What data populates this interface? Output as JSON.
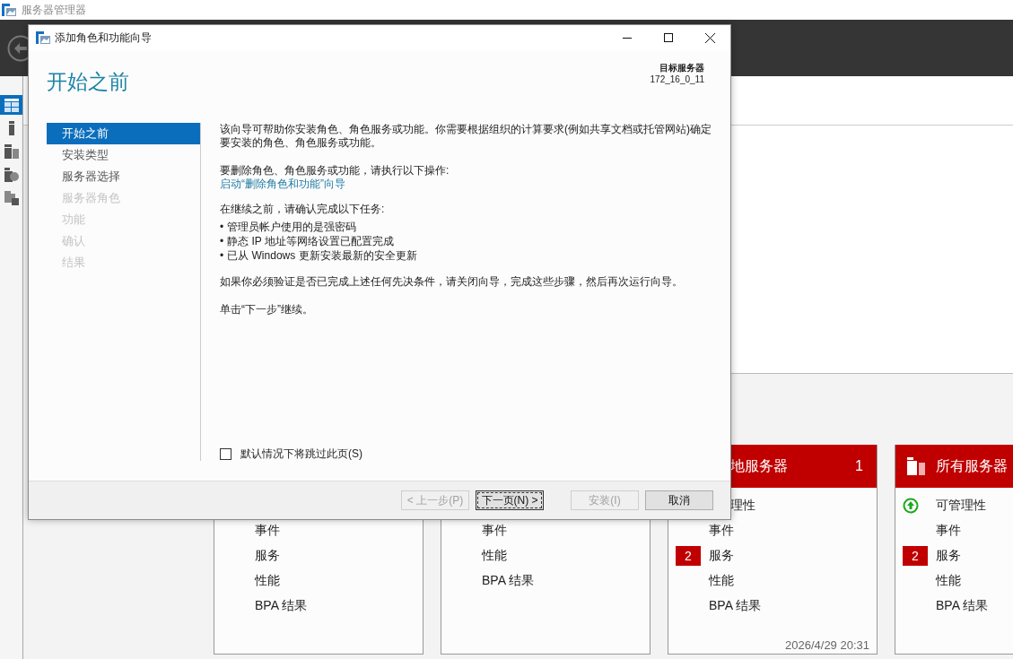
{
  "app": {
    "title": "服务器管理器"
  },
  "nav_items": [
    {
      "selected": true
    },
    {
      "selected": false
    },
    {
      "selected": false
    },
    {
      "selected": false
    },
    {
      "selected": false
    }
  ],
  "cards": [
    {
      "kind": "covered",
      "rows": [
        {
          "kind": "plain",
          "label": "事件"
        },
        {
          "kind": "plain",
          "label": "服务"
        },
        {
          "kind": "plain",
          "label": "性能"
        },
        {
          "kind": "plain",
          "label": "BPA 结果"
        }
      ]
    },
    {
      "kind": "covered",
      "rows": [
        {
          "kind": "plain",
          "label": "事件"
        },
        {
          "kind": "plain",
          "label": "性能"
        },
        {
          "kind": "plain",
          "label": "BPA 结果"
        }
      ]
    },
    {
      "kind": "clipped",
      "title": "地服务器",
      "count": "1",
      "rows": [
        {
          "kind": "clipped",
          "label": "理性"
        },
        {
          "kind": "plain",
          "label": "事件"
        },
        {
          "kind": "badge",
          "badge": "2",
          "label": "服务"
        },
        {
          "kind": "plain",
          "label": "性能"
        },
        {
          "kind": "plain",
          "label": "BPA 结果"
        }
      ],
      "timestamp": "2026/4/29 20:31"
    },
    {
      "kind": "full",
      "title": "所有服务器",
      "rows": [
        {
          "kind": "status",
          "label": "可管理性"
        },
        {
          "kind": "plain",
          "label": "事件"
        },
        {
          "kind": "badge",
          "badge": "2",
          "label": "服务"
        },
        {
          "kind": "plain",
          "label": "性能"
        },
        {
          "kind": "plain",
          "label": "BPA 结果"
        }
      ]
    }
  ],
  "dialog": {
    "title": "添加角色和功能向导",
    "heading": "开始之前",
    "target_label": "目标服务器",
    "target_value": "172_16_0_11",
    "steps": [
      {
        "label": "开始之前",
        "selected": true,
        "disabled": false
      },
      {
        "label": "安装类型",
        "selected": false,
        "disabled": false
      },
      {
        "label": "服务器选择",
        "selected": false,
        "disabled": false
      },
      {
        "label": "服务器角色",
        "selected": false,
        "disabled": true
      },
      {
        "label": "功能",
        "selected": false,
        "disabled": true
      },
      {
        "label": "确认",
        "selected": false,
        "disabled": true
      },
      {
        "label": "结果",
        "selected": false,
        "disabled": true
      }
    ],
    "intro": "该向导可帮助你安装角色、角色服务或功能。你需要根据组织的计算要求(例如共享文档或托管网站)确定要安装的角色、角色服务或功能。",
    "remove_text": "要删除角色、角色服务或功能，请执行以下操作:",
    "remove_link": "启动“删除角色和功能”向导",
    "confirm_text": "在继续之前，请确认完成以下任务:",
    "tasks": [
      {
        "bullet": "•",
        "text": "管理员帐户使用的是强密码"
      },
      {
        "bullet": "•",
        "text": "静态 IP 地址等网络设置已配置完成"
      },
      {
        "bullet": "•",
        "text": "已从 Windows 更新安装最新的安全更新"
      }
    ],
    "verify_text": "如果你必须验证是否已完成上述任何先决条件，请关闭向导，完成这些步骤，然后再次运行向导。",
    "continue_text": "单击“下一步”继续。",
    "skip_checkbox": {
      "label": "默认情况下将跳过此页(S)",
      "checked": false
    },
    "buttons": [
      {
        "label": "< 上一步(P)",
        "disabled": true,
        "focused": false
      },
      {
        "label": "下一页(N) >",
        "disabled": false,
        "focused": true
      },
      {
        "label": "安装(I)",
        "disabled": true,
        "focused": false
      },
      {
        "label": "取消",
        "disabled": false,
        "focused": false
      }
    ]
  }
}
